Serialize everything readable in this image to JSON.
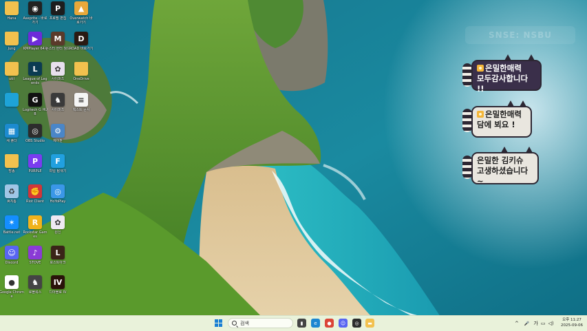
{
  "desktop": {
    "icons": [
      {
        "label": "Hana",
        "glyph": "",
        "color": "#f2c14e",
        "folder": true
      },
      {
        "label": "Aseprite - 바로 가기",
        "glyph": "◉",
        "color": "#222222"
      },
      {
        "label": "프로필 편집",
        "glyph": "P",
        "color": "#1d1d1d"
      },
      {
        "label": "Overwatch 바로가기",
        "glyph": "▲",
        "color": "#e8a83a"
      },
      {
        "label": "Jung",
        "glyph": "",
        "color": "#f2c14e",
        "folder": true
      },
      {
        "label": "KMPlayer 64X",
        "glyph": "▶",
        "color": "#6d2bd9"
      },
      {
        "label": "몬스터 헌터 월드",
        "glyph": "M",
        "color": "#5a3a2a"
      },
      {
        "label": "ROAD 바로가기",
        "glyph": "D",
        "color": "#2a1a12"
      },
      {
        "label": "util",
        "glyph": "",
        "color": "#f2c14e",
        "folder": true
      },
      {
        "label": "League of Legends",
        "glyph": "L",
        "color": "#0b3b52"
      },
      {
        "label": "사이퍼즈",
        "glyph": "✿",
        "color": "#e8e0ee"
      },
      {
        "label": "OneDrive",
        "glyph": "",
        "color": "#f2c14e",
        "folder": true
      },
      {
        "label": "",
        "glyph": "",
        "color": "#1ea3d8"
      },
      {
        "label": "Logitech G HUB",
        "glyph": "G",
        "color": "#111111"
      },
      {
        "label": "사이퍼즈",
        "glyph": "♞",
        "color": "#3a3a3a"
      },
      {
        "label": "텍스트 문서",
        "glyph": "≡",
        "color": "#f5f5f5"
      },
      {
        "label": "새 폴더",
        "glyph": "▦",
        "color": "#1c8bd0"
      },
      {
        "label": "OBS Studio",
        "glyph": "◎",
        "color": "#2c2c2c"
      },
      {
        "label": "제어판",
        "glyph": "⚙",
        "color": "#4a86c8"
      },
      {
        "label": "방송",
        "glyph": "",
        "color": "#f2c14e",
        "folder": true
      },
      {
        "label": "PURPLE",
        "glyph": "P",
        "color": "#7a3cf0"
      },
      {
        "label": "파일 탐색기",
        "glyph": "F",
        "color": "#21a0e0"
      },
      {
        "label": "휴지통",
        "glyph": "♻",
        "color": "#9fc6e6"
      },
      {
        "label": "Riot Client",
        "glyph": "✊",
        "color": "#d13639"
      },
      {
        "label": "HoYoPlay",
        "glyph": "◎",
        "color": "#3a97e8"
      },
      {
        "label": "Battle.net",
        "glyph": "✶",
        "color": "#148eff"
      },
      {
        "label": "Rockstar Games",
        "glyph": "R",
        "color": "#f1b31c"
      },
      {
        "label": "원신",
        "glyph": "✿",
        "color": "#efe9f2"
      },
      {
        "label": "Discord",
        "glyph": "☺",
        "color": "#5865f2"
      },
      {
        "label": "STOVE",
        "glyph": "♪",
        "color": "#8a3bd6"
      },
      {
        "label": "로스트아크",
        "glyph": "L",
        "color": "#3a2418"
      },
      {
        "label": "Google Chrome",
        "glyph": "●",
        "color": "#ffffff"
      },
      {
        "label": "로블록스",
        "glyph": "♞",
        "color": "#444444"
      },
      {
        "label": "디아블로 IV",
        "glyph": "IV",
        "color": "#2a120a"
      }
    ]
  },
  "watermark": {
    "text": "SNSE: NSBU"
  },
  "bubbles": [
    {
      "line1": "은밀한매력",
      "line2": "모두감사합니다 !!",
      "bg": "#3a2f4a",
      "fg": "#ffffff"
    },
    {
      "line1": "은밀한매력",
      "line2": "담에 뵈요 !",
      "bg": "#e9e6df",
      "fg": "#1e1e1e"
    },
    {
      "line1": "은밀한 김키슈",
      "line2": "고생하셨습니다~",
      "bg": "#e9e6df",
      "fg": "#1e1e1e"
    }
  ],
  "taskbar": {
    "search_placeholder": "검색",
    "apps": [
      {
        "name": "file-explorer-icon",
        "glyph": "▮",
        "color": "#444444"
      },
      {
        "name": "edge-icon",
        "glyph": "e",
        "color": "#1d86d1"
      },
      {
        "name": "chrome-icon",
        "glyph": "●",
        "color": "#db4437"
      },
      {
        "name": "discord-icon",
        "glyph": "☺",
        "color": "#5865f2"
      },
      {
        "name": "obs-icon",
        "glyph": "◎",
        "color": "#2c2c2c"
      },
      {
        "name": "folder-icon",
        "glyph": "▬",
        "color": "#f2c14e"
      }
    ],
    "tray": {
      "chevron": "^",
      "mic": "🎤",
      "network": "▭",
      "volume": "◁)",
      "ime": "가"
    },
    "clock": {
      "time": "오후 11:27",
      "date": "2025-09-06"
    }
  }
}
